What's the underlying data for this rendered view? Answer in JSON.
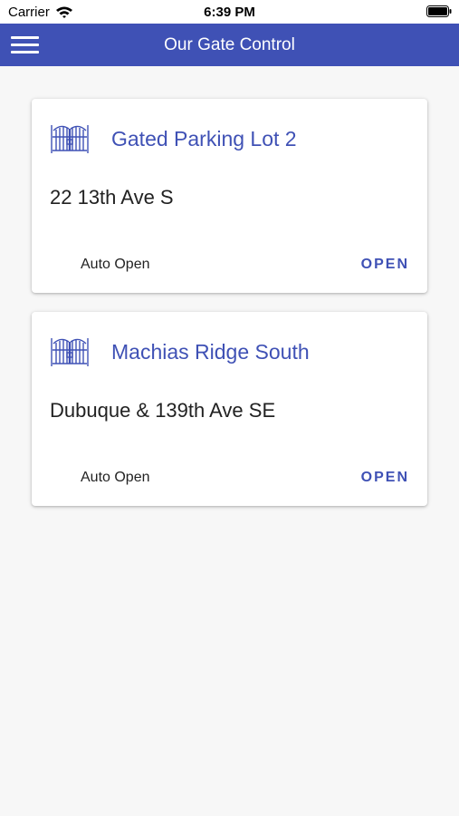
{
  "status_bar": {
    "carrier": "Carrier",
    "time": "6:39 PM"
  },
  "app_bar": {
    "title": "Our Gate Control",
    "color": "#3f51b5"
  },
  "gates": [
    {
      "name": "Gated Parking Lot 2",
      "address": "22 13th Ave S",
      "auto_open_label": "Auto Open",
      "open_label": "OPEN"
    },
    {
      "name": "Machias Ridge South",
      "address": "Dubuque & 139th Ave SE",
      "auto_open_label": "Auto Open",
      "open_label": "OPEN"
    }
  ]
}
